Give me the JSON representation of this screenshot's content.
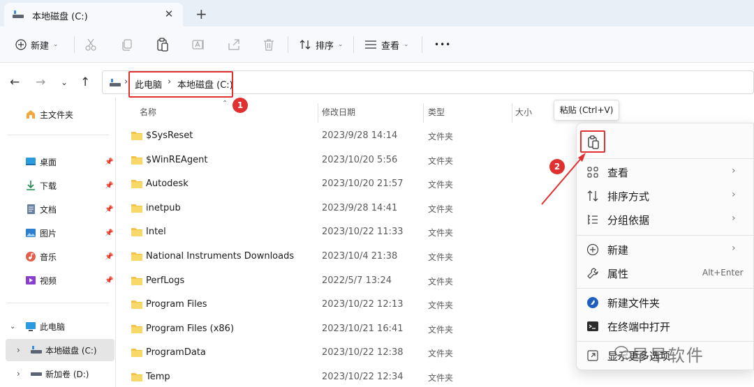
{
  "tab": {
    "title": "本地磁盘 (C:)",
    "close": "✕",
    "new": "+"
  },
  "commands": {
    "new_label": "新建",
    "sort_label": "排序",
    "view_label": "查看",
    "more": "•••"
  },
  "breadcrumb": {
    "items": [
      "此电脑",
      "本地磁盘 (C:)"
    ],
    "sep": "›"
  },
  "badges": {
    "one": "1",
    "two": "2"
  },
  "sidebar": {
    "home": "主文件夹",
    "quick": [
      {
        "label": "桌面"
      },
      {
        "label": "下载"
      },
      {
        "label": "文档"
      },
      {
        "label": "图片"
      },
      {
        "label": "音乐"
      },
      {
        "label": "视频"
      }
    ],
    "this_pc": "此电脑",
    "drives": [
      {
        "label": "本地磁盘 (C:)"
      },
      {
        "label": "新加卷 (D:)"
      }
    ]
  },
  "columns": {
    "name": "名称",
    "modified": "修改日期",
    "type": "类型",
    "size": "大小"
  },
  "files": [
    {
      "name": "$SysReset",
      "date": "2023/9/28 14:14",
      "type": "文件夹"
    },
    {
      "name": "$WinREAgent",
      "date": "2023/10/20 5:56",
      "type": "文件夹"
    },
    {
      "name": "Autodesk",
      "date": "2023/10/20 21:57",
      "type": "文件夹"
    },
    {
      "name": "inetpub",
      "date": "2023/9/28 14:41",
      "type": "文件夹"
    },
    {
      "name": "Intel",
      "date": "2023/10/22 11:33",
      "type": "文件夹"
    },
    {
      "name": "National Instruments Downloads",
      "date": "2023/10/4 21:38",
      "type": "文件夹"
    },
    {
      "name": "PerfLogs",
      "date": "2022/5/7 13:24",
      "type": "文件夹"
    },
    {
      "name": "Program Files",
      "date": "2023/10/22 12:13",
      "type": "文件夹"
    },
    {
      "name": "Program Files (x86)",
      "date": "2023/10/21 16:41",
      "type": "文件夹"
    },
    {
      "name": "ProgramData",
      "date": "2023/10/22 12:38",
      "type": "文件夹"
    },
    {
      "name": "Temp",
      "date": "2023/10/22 12:34",
      "type": "文件夹"
    }
  ],
  "tooltip": "粘贴 (Ctrl+V)",
  "context_menu": {
    "view": "查看",
    "sort": "排序方式",
    "group": "分组依据",
    "new": "新建",
    "properties": "属性",
    "properties_shortcut": "Alt+Enter",
    "new_folder": "新建文件夹",
    "terminal": "在终端中打开",
    "more": "显示更多选项"
  },
  "watermark": "早早软件",
  "colors": {
    "accent": "#0067c0",
    "highlight": "#e03030",
    "folder": "#f4c142"
  }
}
